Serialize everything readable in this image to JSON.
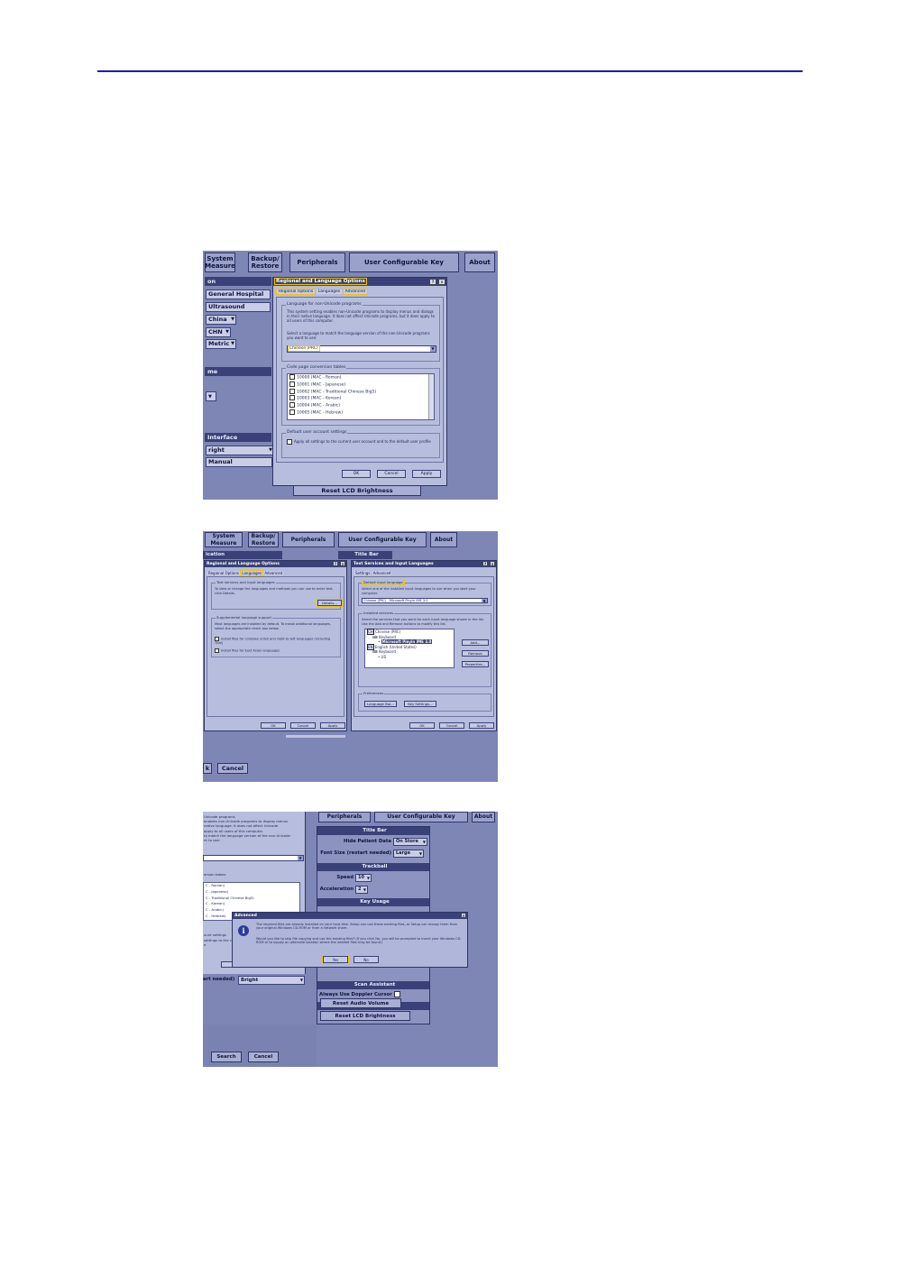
{
  "screenshot1": {
    "tabs": [
      "System Measure",
      "Backup/ Restore",
      "Peripherals",
      "User Configurable Key",
      "About"
    ],
    "left": {
      "header1": "on",
      "hospital": "General Hospital",
      "department": "Ultrasound",
      "country": "China",
      "language": "CHN",
      "units": "Metric",
      "header2": "me",
      "header3": "Interface",
      "bright": "right",
      "manual": "Manual"
    },
    "dialog": {
      "title": "Regional and Language Options",
      "tabs": [
        "Regional Options",
        "Languages",
        "Advanced"
      ],
      "group1_label": "Language for non-Unicode programs",
      "group1_text": "This system setting enables non-Unicode programs to display menus and dialogs in their native language. It does not affect Unicode programs, but it does apply to all users of this computer.",
      "group1_text2": "Select a language to match the language version of the non-Unicode programs you want to use:",
      "selected_language": "Chinese (PRC)",
      "group2_label": "Code page conversion tables",
      "code_pages": [
        "10000 (MAC - Roman)",
        "10001 (MAC - Japanese)",
        "10002 (MAC - Traditional Chinese Big5)",
        "10003 (MAC - Korean)",
        "10004 (MAC - Arabic)",
        "10005 (MAC - Hebrew)"
      ],
      "group3_label": "Default user account settings",
      "group3_text": "Apply all settings to the current user account and to the default user profile",
      "ok": "OK",
      "cancel": "Cancel",
      "apply": "Apply"
    },
    "reset_lcd": "Reset LCD Brightness"
  },
  "screenshot2": {
    "tabs": [
      "System Measure",
      "Backup/ Restore",
      "Peripherals",
      "User Configurable Key",
      "About"
    ],
    "header_left": "ication",
    "header_right": "Title Bar",
    "dialog1": {
      "title": "Regional and Language Options",
      "tabs": [
        "Regional Options",
        "Languages",
        "Advanced"
      ],
      "group1_label": "Text services and input languages",
      "group1_text": "To view or change the languages and methods you can use to enter text, click Details.",
      "details": "Details...",
      "group2_label": "Supplemental language support",
      "group2_text": "Most languages are installed by default. To install additional languages, select the appropriate check box below.",
      "check1": "Install files for complex script and right-to-left languages (including Thai)",
      "check2": "Install files for East Asian languages",
      "ok": "OK",
      "cancel": "Cancel",
      "apply": "Apply"
    },
    "dialog2": {
      "title": "Text Services and Input Languages",
      "tabs": [
        "Settings",
        "Advanced"
      ],
      "group1_label": "Default input language",
      "group1_text": "Select one of the installed input languages to use when you start your computer.",
      "default_input": "Chinese (PRC) - Microsoft Pinyin IME 3.0",
      "group2_label": "Installed services",
      "group2_text": "Select the services that you want for each input language shown in the list. Use the Add and Remove buttons to modify this list.",
      "tree": [
        "Chinese (PRC)",
        "Keyboard",
        "Microsoft Pinyin IME 3.0",
        "English (United States)",
        "Keyboard",
        "US"
      ],
      "add": "Add...",
      "remove": "Remove",
      "properties": "Properties...",
      "group3_label": "Preferences",
      "language_bar": "Language Bar...",
      "key_settings": "Key Settings...",
      "ok": "OK",
      "cancel": "Cancel",
      "apply": "Apply"
    },
    "bottom_left": "k",
    "bottom_cancel": "Cancel"
  },
  "screenshot3": {
    "tabs": [
      "Peripherals",
      "User Configurable Key",
      "About"
    ],
    "left_text": [
      "Unicode programs",
      "enables non-Unicode programs to display menus",
      "native language. It does not affect Unicode",
      "apply to all users of this computer.",
      "to match the language version of the non-Unicode",
      "nt to use:"
    ],
    "left_label": "ersion tables",
    "left_list": [
      "C - Roman)",
      "C - Japanese)",
      "C - Traditional Chinese Big5)",
      "C - Korean)",
      "C - Arabic)",
      "C - Hebrew)"
    ],
    "left_label2": "ount settings",
    "left_text2": [
      "settings to the cu",
      "e"
    ],
    "title_bar": "Title Bar",
    "hide_patient_data": "Hide Patient Data",
    "hide_patient_value": "On Store",
    "font_size": "Font Size (restart needed)",
    "font_size_value": "Large",
    "trackball": "Trackball",
    "speed": "Speed",
    "speed_value": "10",
    "acceleration": "Acceleration",
    "acceleration_value": "2",
    "key_usage": "Key Usage",
    "dialog": {
      "title": "Advanced",
      "text1": "The required files are already installed on your hard disk. Setup can use these existing files, or Setup can recopy them from your original Windows CD-ROM or from a network share.",
      "text2": "Would you like to skip file copying and use the existing files? (If you click No, you will be prompted to insert your Windows CD-ROM or to supply an alternate location where the needed files may be found.)",
      "yes": "Yes",
      "no": "No"
    },
    "scan_assistant": "Scan Assistant",
    "doppler_cursor": "Always Use Doppler Cursor",
    "audio_lcd": "Audio And LCD",
    "reset_audio": "Reset Audio Volume",
    "reset_lcd": "Reset LCD Brightness",
    "restart_needed": "art needed)",
    "bright": "Bright",
    "search": "Search",
    "cancel": "Cancel"
  }
}
